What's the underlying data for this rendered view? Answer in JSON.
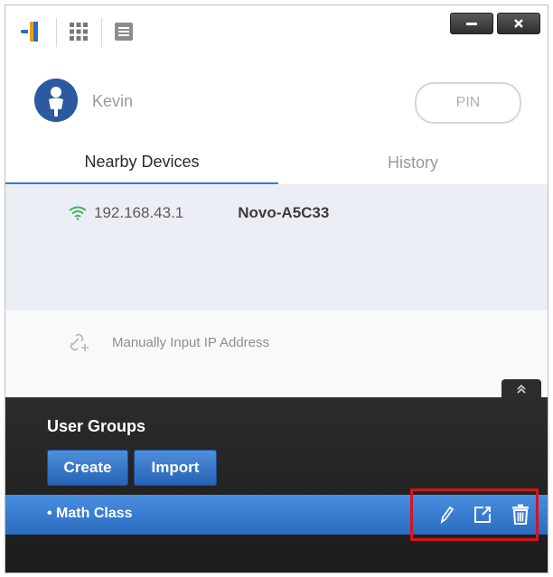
{
  "toolbar": {
    "icons": [
      "app-logo-icon",
      "grid-icon",
      "list-icon"
    ],
    "minimize_icon": "minimize-icon",
    "close_icon": "close-icon"
  },
  "user": {
    "name": "Kevin",
    "avatar_icon": "user-avatar-icon",
    "pin_label": "PIN"
  },
  "tabs": {
    "nearby": "Nearby Devices",
    "history": "History",
    "active": "nearby"
  },
  "devices": [
    {
      "ip": "192.168.43.1",
      "name": "Novo-A5C33",
      "signal_icon": "wifi-icon"
    }
  ],
  "manual": {
    "label": "Manually Input IP Address",
    "icon": "link-add-icon"
  },
  "panel": {
    "collapse_icon": "double-chevron-up-icon",
    "title": "User Groups",
    "create_label": "Create",
    "import_label": "Import",
    "groups": [
      {
        "name": "Math Class"
      }
    ],
    "actions": [
      "edit-pencil-icon",
      "export-icon",
      "trash-icon"
    ]
  },
  "colors": {
    "accent": "#3b78c4",
    "selected_row": "#3a7dd0",
    "panel_bg": "#242424",
    "highlight": "#d6141f"
  }
}
